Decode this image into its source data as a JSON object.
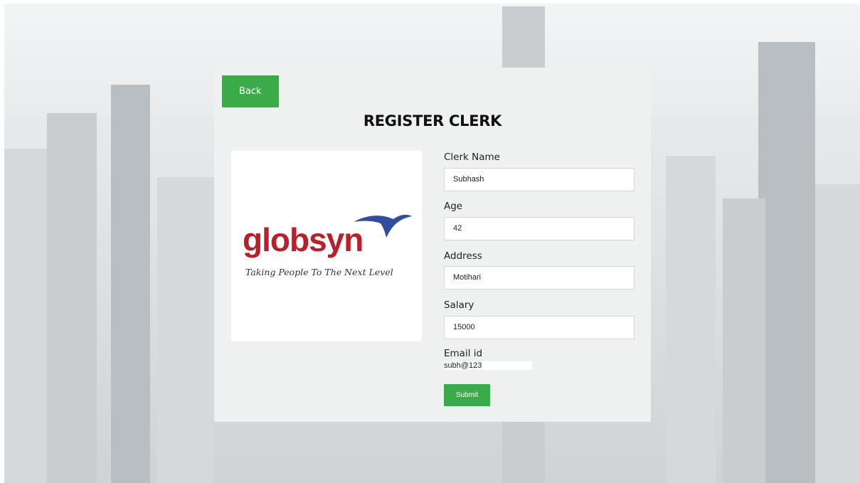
{
  "header": {
    "back_label": "Back",
    "title": "REGISTER CLERK"
  },
  "logo": {
    "word": "globsyn",
    "tagline": "Taking People To The Next Level",
    "color": "#b8202b",
    "bird_color": "#2f4f9c"
  },
  "form": {
    "fields": [
      {
        "label": "Clerk Name",
        "value": "Subhash"
      },
      {
        "label": "Age",
        "value": "42"
      },
      {
        "label": "Address",
        "value": "Motihari"
      },
      {
        "label": "Salary",
        "value": "15000"
      }
    ],
    "email": {
      "label": "Email id",
      "value": "subh@123"
    },
    "submit_label": "Submit"
  },
  "colors": {
    "accent": "#3bab4a",
    "card": "#eff0f0"
  }
}
